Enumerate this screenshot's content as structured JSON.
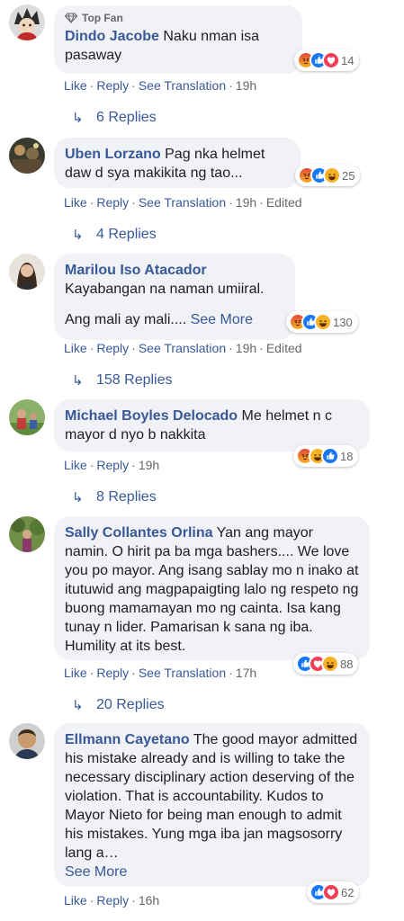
{
  "ui": {
    "like": "Like",
    "reply": "Reply",
    "see_translation": "See Translation",
    "edited": "Edited",
    "see_more": "See More"
  },
  "comments": [
    {
      "badge": "Top Fan",
      "name": "Dindo Jacobe",
      "text": "Naku nman isa pasaway",
      "time": "19h",
      "reactions": [
        "angry",
        "like",
        "love"
      ],
      "reaction_count": "14",
      "replies": "6 Replies"
    },
    {
      "name": "Uben Lorzano",
      "text": "Pag nka helmet daw d sya makikita ng tao...",
      "time": "19h",
      "reactions": [
        "angry",
        "like",
        "haha"
      ],
      "reaction_count": "25",
      "replies": "4 Replies"
    },
    {
      "name": "Marilou Iso Atacador",
      "text": "Kayabangan na naman umiiral.",
      "text2": "Ang mali ay mali....",
      "time": "19h",
      "reactions": [
        "angry",
        "like",
        "haha"
      ],
      "reaction_count": "130",
      "replies": "158 Replies"
    },
    {
      "name": "Michael Boyles Delocado",
      "text": "Me helmet n c mayor d nyo b nakkita",
      "time": "19h",
      "reactions": [
        "angry",
        "haha",
        "like"
      ],
      "reaction_count": "18",
      "replies": "8 Replies"
    },
    {
      "name": "Sally Collantes Orlina",
      "text": "Yan ang mayor namin. O hirit pa ba mga bashers.... We love you po mayor. Ang isang sablay mo n inako at itutuwid ang magpapaigting lalo ng respeto ng buong mamamayan mo ng cainta. Isa kang tunay n lider. Pamarisan k sana ng iba. Humility at its best.",
      "time": "17h",
      "reactions": [
        "like",
        "love",
        "haha"
      ],
      "reaction_count": "88",
      "replies": "20 Replies"
    },
    {
      "name": "Ellmann Cayetano",
      "text": "The good mayor admitted his mistake already and is willing to take the necessary disciplinary action deserving of the violation. That is accountability. Kudos to Mayor Nieto for being man enough to admit his mistakes. Yung mga iba jan magsosorry lang a…",
      "time": "16h",
      "reactions": [
        "like",
        "love"
      ],
      "reaction_count": "62"
    }
  ]
}
